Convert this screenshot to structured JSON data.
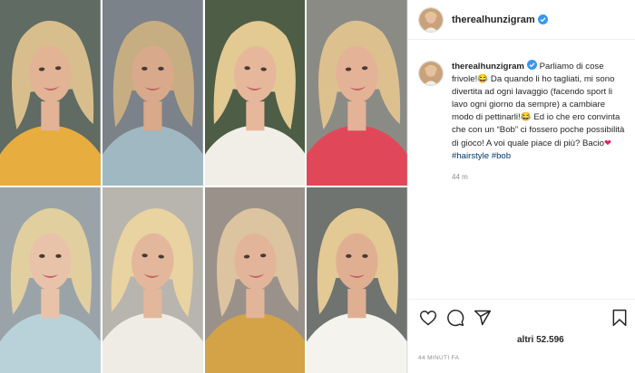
{
  "post": {
    "images": [
      {
        "name": "photo-1",
        "bg": "#5f6b63",
        "hair": "#d8be8c",
        "skin": "#e2b395",
        "top": "#e7ad3f"
      },
      {
        "name": "photo-2",
        "bg": "#7c8289",
        "hair": "#c7ad82",
        "skin": "#d9a98b",
        "top": "#9fb8c2"
      },
      {
        "name": "photo-3",
        "bg": "#4e5d45",
        "hair": "#e3c992",
        "skin": "#e6b79b",
        "top": "#f1eee8"
      },
      {
        "name": "photo-4",
        "bg": "#8b8b86",
        "hair": "#dcc18f",
        "skin": "#e4b297",
        "top": "#e0485a"
      },
      {
        "name": "photo-5",
        "bg": "#9aa4a8",
        "hair": "#e1cfa0",
        "skin": "#e9c3a9",
        "top": "#b9d2d9"
      },
      {
        "name": "photo-6",
        "bg": "#b8b5ae",
        "hair": "#e8d3a1",
        "skin": "#e3b79b",
        "top": "#efece6"
      },
      {
        "name": "photo-7",
        "bg": "#9a928a",
        "hair": "#dcc4a0",
        "skin": "#e2b59a",
        "top": "#d4a347"
      },
      {
        "name": "photo-8",
        "bg": "#6f7470",
        "hair": "#e3c994",
        "skin": "#e0af92",
        "top": "#f4f3ee"
      }
    ]
  },
  "header": {
    "username": "therealhunzigram"
  },
  "caption": {
    "username": "therealhunzigram",
    "text_1": " Parliamo di cose frivole!",
    "emoji_1": "😂",
    "text_2": " Da quando li ho tagliati, mi sono divertita ad ogni lavaggio (facendo sport li lavo ogni giorno da sempre) a cambiare modo di pettinarli!",
    "emoji_2": "😂",
    "text_3": " Ed io che ero convinta che con un “Bob” ci fossero poche possibilità di gioco! A voi quale piace di più? Bacio",
    "heart": "❤",
    "hashtag_1": "#hairstyle",
    "hashtag_2": "#bob",
    "time": "44 m"
  },
  "actions": {
    "likes": "altri 52.596",
    "timestamp": "44 MINUTI FA"
  },
  "colors": {
    "link": "#00376b",
    "muted": "#8e8e8e",
    "verified": "#3897f0"
  },
  "icons": [
    "heart-icon",
    "comment-icon",
    "share-icon",
    "bookmark-icon",
    "verified-badge-icon"
  ]
}
